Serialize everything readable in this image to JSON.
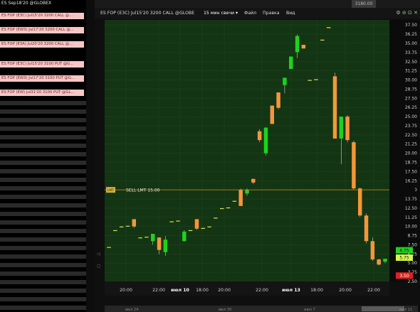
{
  "left_panel": {
    "header": "ES Sep18'20 @GLOBEX",
    "items": [
      "ES FOP (E3C) Jul15'20 3200 CALL @...",
      "ES FOP (EW3) Jul17'20 3200 CALL @...",
      "ES FOP (E3A) Jul20'20 3200 CALL @...",
      "ES FOP (E3C) Jul15'20 3100 PUT @G...",
      "ES FOP (EW3) Jul17'20 3100 PUT @G...",
      "ES FOP (EW) Jul31'20 3100 PUT @GL..."
    ]
  },
  "top_price": "3180.00",
  "titlebar": {
    "title": "ES FOP (E3C) Jul15'20 3200 CALL @GLOBE",
    "timeframe": "15 мин свечи",
    "menu": [
      "Файл",
      "Правка",
      "Вид"
    ]
  },
  "order_line": {
    "price": 15.0,
    "badge": "LMT",
    "label": "SELL LMT 15.00"
  },
  "price_tags": {
    "green1": "6.75",
    "green2": "5.75",
    "red": "3.50"
  },
  "x_axis": {
    "ticks": [
      "20:00",
      "22:00",
      "июл 10",
      "18:00",
      "20:00",
      "22:00",
      "июл 13",
      "18:00",
      "20:00",
      "22:00"
    ],
    "sub_ticks": [
      "июл 24",
      "июл 30",
      "июл 7",
      "июл 11"
    ]
  },
  "chart_data": {
    "type": "candlestick",
    "y_ticks": [
      "37.50",
      "36.25",
      "35.00",
      "33.75",
      "32.50",
      "31.25",
      "30.00",
      "28.75",
      "27.50",
      "26.25",
      "25.00",
      "23.75",
      "22.50",
      "21.25",
      "20.00",
      "18.75",
      "17.50",
      "16.25",
      "15.00",
      "13.75",
      "12.50",
      "11.25",
      "10.00",
      "8.75",
      "7.50",
      "6.25",
      "5.00",
      "3.75",
      "2.50"
    ],
    "ylim": [
      2.5,
      38.2
    ],
    "colors": {
      "up": "#1fd11f",
      "down": "#f5963c",
      "flat": "#e2e24a",
      "background": "#143514",
      "grid": "#2a5a2a"
    },
    "candles": [
      {
        "o": 7.2,
        "h": 7.2,
        "l": 7.2,
        "c": 7.2
      },
      {
        "o": 9.5,
        "h": 9.5,
        "l": 9.5,
        "c": 9.5
      },
      {
        "o": 10.0,
        "h": 10.0,
        "l": 10.0,
        "c": 10.0
      },
      {
        "o": 10.1,
        "h": 10.1,
        "l": 10.1,
        "c": 10.1
      },
      {
        "o": 11.0,
        "h": 11.0,
        "l": 9.8,
        "c": 10.0
      },
      {
        "o": 8.5,
        "h": 8.5,
        "l": 8.5,
        "c": 8.5
      },
      {
        "o": 8.6,
        "h": 8.6,
        "l": 8.6,
        "c": 8.6
      },
      {
        "o": 8.0,
        "h": 8.9,
        "l": 7.5,
        "c": 9.0
      },
      {
        "o": 8.5,
        "h": 8.5,
        "l": 6.2,
        "c": 6.8
      },
      {
        "o": 6.5,
        "h": 8.7,
        "l": 6.0,
        "c": 8.2
      },
      {
        "o": 10.7,
        "h": 10.7,
        "l": 10.7,
        "c": 10.7
      },
      {
        "o": 10.8,
        "h": 10.8,
        "l": 10.8,
        "c": 10.8
      },
      {
        "o": 8.0,
        "h": 9.5,
        "l": 8.0,
        "c": 9.3
      },
      {
        "o": 9.5,
        "h": 9.5,
        "l": 9.5,
        "c": 9.5
      },
      {
        "o": 11.0,
        "h": 11.0,
        "l": 9.5,
        "c": 9.7
      },
      {
        "o": 9.8,
        "h": 9.8,
        "l": 9.8,
        "c": 9.8
      },
      {
        "o": 10.0,
        "h": 10.0,
        "l": 10.0,
        "c": 10.0
      },
      {
        "o": 11.2,
        "h": 11.2,
        "l": 11.2,
        "c": 11.2
      },
      {
        "o": 12.5,
        "h": 12.5,
        "l": 12.5,
        "c": 12.5
      },
      {
        "o": 12.6,
        "h": 12.6,
        "l": 12.6,
        "c": 12.6
      },
      {
        "o": 13.5,
        "h": 13.5,
        "l": 13.5,
        "c": 13.5
      },
      {
        "o": 15.0,
        "h": 15.2,
        "l": 12.8,
        "c": 12.8
      },
      {
        "o": 14.5,
        "h": 15.2,
        "l": 14.2,
        "c": 15.0
      },
      {
        "o": 16.5,
        "h": 16.5,
        "l": 15.8,
        "c": 16.0
      },
      {
        "o": 23.0,
        "h": 23.3,
        "l": 21.5,
        "c": 21.8
      },
      {
        "o": 20.0,
        "h": 23.5,
        "l": 19.7,
        "c": 23.5
      },
      {
        "o": 26.5,
        "h": 26.5,
        "l": 24.0,
        "c": 24.0
      },
      {
        "o": 28.3,
        "h": 28.3,
        "l": 26.0,
        "c": 26.2
      },
      {
        "o": 29.3,
        "h": 29.5,
        "l": 28.2,
        "c": 30.3
      },
      {
        "o": 31.5,
        "h": 33.0,
        "l": 31.5,
        "c": 33.2
      },
      {
        "o": 33.8,
        "h": 36.2,
        "l": 33.0,
        "c": 36.0
      },
      {
        "o": 34.8,
        "h": 34.8,
        "l": 34.3,
        "c": 34.3
      },
      {
        "o": 30.0,
        "h": 30.0,
        "l": 30.0,
        "c": 30.0
      },
      {
        "o": 30.1,
        "h": 30.1,
        "l": 30.1,
        "c": 30.1
      },
      {
        "o": 35.5,
        "h": 35.5,
        "l": 35.5,
        "c": 35.5
      },
      {
        "o": 37.2,
        "h": 37.2,
        "l": 37.2,
        "c": 37.2
      },
      {
        "o": 30.5,
        "h": 31.0,
        "l": 22.0,
        "c": 22.0
      },
      {
        "o": 22.0,
        "h": 23.5,
        "l": 18.5,
        "c": 25.0
      },
      {
        "o": 25.0,
        "h": 25.2,
        "l": 21.5,
        "c": 21.8
      },
      {
        "o": 21.5,
        "h": 21.7,
        "l": 15.0,
        "c": 15.2
      },
      {
        "o": 15.2,
        "h": 15.3,
        "l": 11.3,
        "c": 11.5
      },
      {
        "o": 11.5,
        "h": 11.8,
        "l": 7.7,
        "c": 8.0
      },
      {
        "o": 8.0,
        "h": 8.5,
        "l": 5.3,
        "c": 5.5
      },
      {
        "o": 5.5,
        "h": 5.6,
        "l": 4.7,
        "c": 4.8
      },
      {
        "o": 5.2,
        "h": 5.6,
        "l": 5.0,
        "c": 5.6
      }
    ]
  }
}
